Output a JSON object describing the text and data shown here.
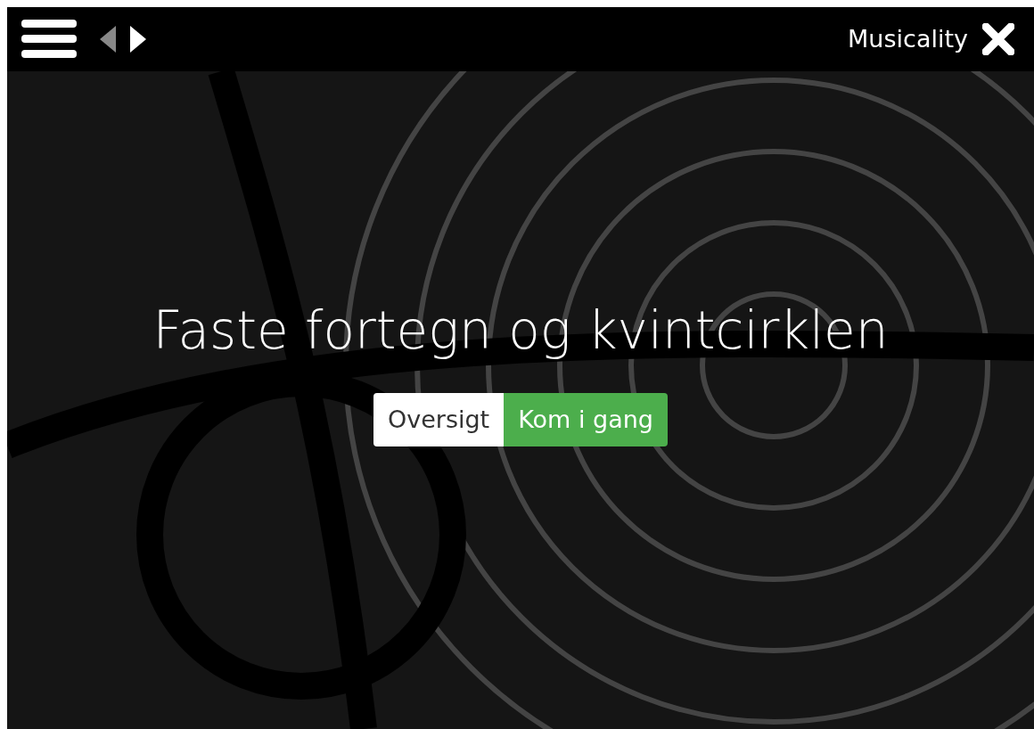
{
  "top_bar": {
    "nav_arrows": [
      {
        "kind": "previous",
        "disabled": true
      },
      {
        "kind": "next",
        "disabled": false
      }
    ],
    "title": "Musicality"
  },
  "hero": {
    "heading": "Faste fortegn og kvintcirklen",
    "buttons": [
      {
        "label": "Oversigt",
        "kind": "plain"
      },
      {
        "label": "Kom i gang",
        "kind": "go"
      }
    ]
  }
}
